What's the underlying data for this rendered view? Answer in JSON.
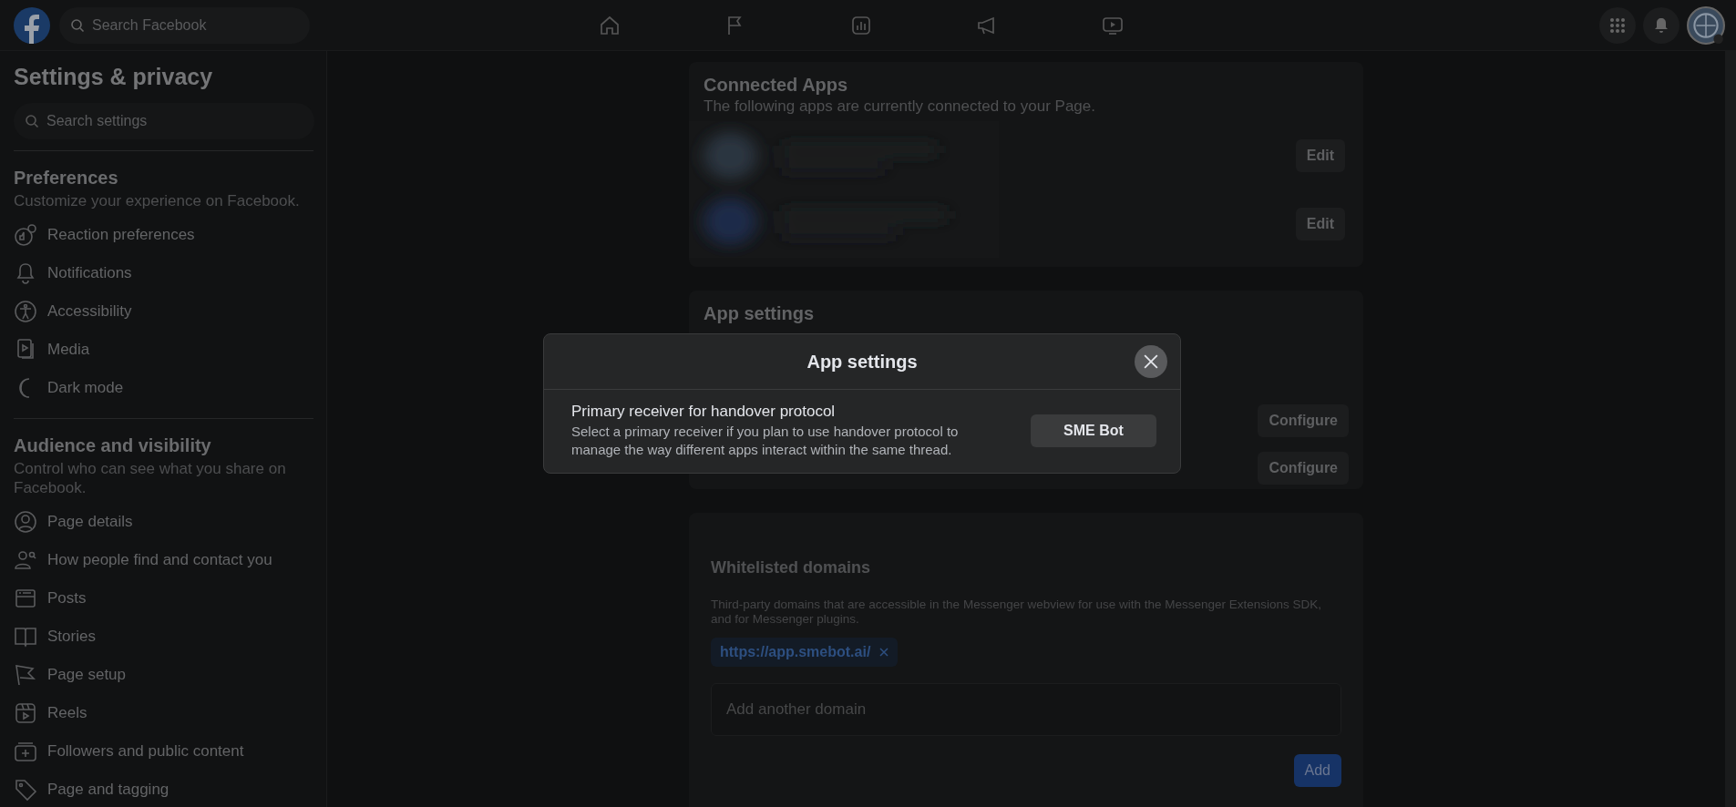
{
  "topbar": {
    "search": {
      "placeholder": "Search Facebook"
    },
    "nav": [
      {
        "kind": "home"
      },
      {
        "kind": "flag"
      },
      {
        "kind": "insights"
      },
      {
        "kind": "megaphone"
      },
      {
        "kind": "video"
      }
    ]
  },
  "sidebar": {
    "title": "Settings & privacy",
    "search": {
      "placeholder": "Search settings"
    },
    "sections": [
      {
        "title": "Preferences",
        "description": "Customize your experience on Facebook.",
        "items": [
          {
            "label": "Reaction preferences",
            "kind": "reaction"
          },
          {
            "label": "Notifications",
            "kind": "bell"
          },
          {
            "label": "Accessibility",
            "kind": "accessibility"
          },
          {
            "label": "Media",
            "kind": "media"
          },
          {
            "label": "Dark mode",
            "kind": "moon"
          }
        ]
      },
      {
        "title": "Audience and visibility",
        "description": "Control who can see what you share on Facebook.",
        "items": [
          {
            "label": "Page details",
            "kind": "person"
          },
          {
            "label": "How people find and contact you",
            "kind": "people"
          },
          {
            "label": "Posts",
            "kind": "posts"
          },
          {
            "label": "Stories",
            "kind": "book"
          },
          {
            "label": "Page setup",
            "kind": "flag"
          },
          {
            "label": "Reels",
            "kind": "reels"
          },
          {
            "label": "Followers and public content",
            "kind": "followers"
          },
          {
            "label": "Page and tagging",
            "kind": "tag"
          }
        ]
      }
    ]
  },
  "connected_apps": {
    "title": "Connected Apps",
    "description": "The following apps are currently connected to your Page.",
    "rows": [
      {
        "button": "Edit"
      },
      {
        "button": "Edit"
      }
    ]
  },
  "app_settings": {
    "title": "App settings",
    "rows": [
      {
        "button": "Configure"
      },
      {
        "button": "Configure"
      }
    ]
  },
  "whitelisted_domains": {
    "title": "Whitelisted domains",
    "description": "Third-party domains that are accessible in the Messenger webview for use with the Messenger Extensions SDK, and for Messenger plugins.",
    "domains": [
      "https://app.smebot.ai/"
    ],
    "input": {
      "placeholder": "Add another domain"
    },
    "button": "Add"
  },
  "dialog": {
    "title": "App settings",
    "setting": {
      "label": "Primary receiver for handover protocol",
      "description": "Select a primary receiver if you plan to use handover protocol to manage the way different apps interact within the same thread.",
      "value": "SME Bot"
    }
  }
}
